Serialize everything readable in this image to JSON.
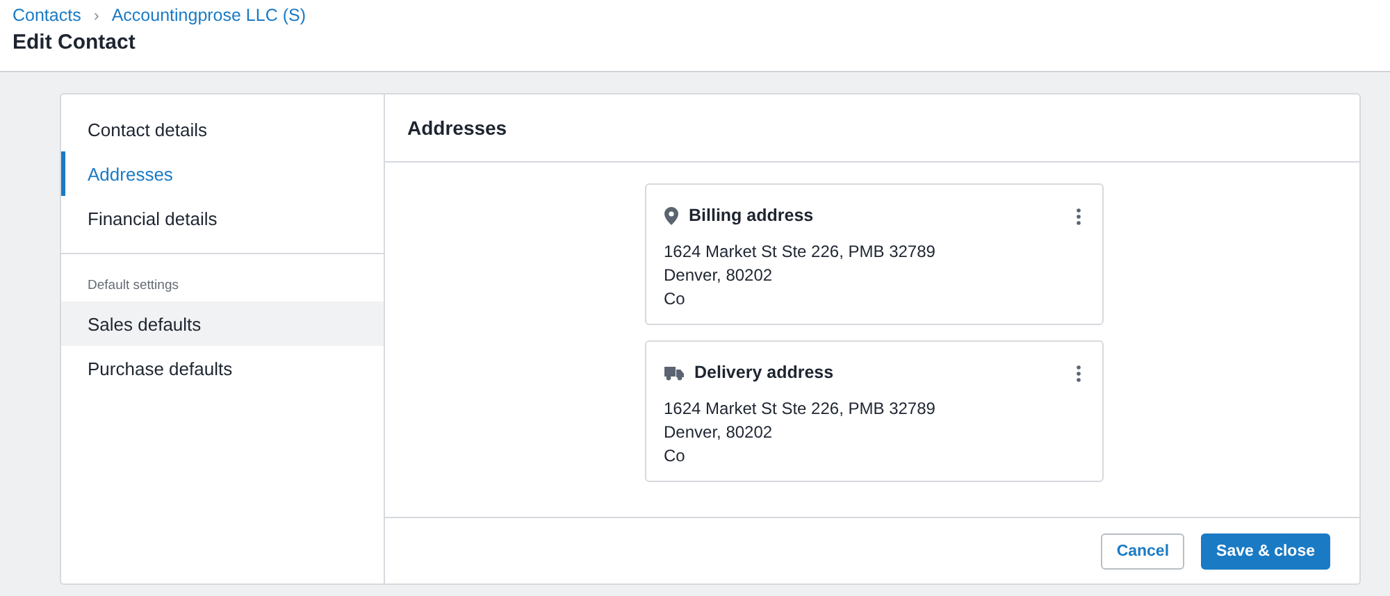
{
  "breadcrumb": [
    {
      "label": "Contacts"
    },
    {
      "label": "Accountingprose LLC (S)"
    }
  ],
  "breadcrumb_separator": "›",
  "page_title": "Edit Contact",
  "sidebar": {
    "items": [
      {
        "label": "Contact details",
        "selected": false,
        "hovered": false
      },
      {
        "label": "Addresses",
        "selected": true,
        "hovered": false
      },
      {
        "label": "Financial details",
        "selected": false,
        "hovered": false
      }
    ],
    "section": {
      "heading": "Default settings",
      "items": [
        {
          "label": "Sales defaults",
          "selected": false,
          "hovered": true
        },
        {
          "label": "Purchase defaults",
          "selected": false,
          "hovered": false
        }
      ]
    }
  },
  "content": {
    "title": "Addresses",
    "cards": [
      {
        "kind": "billing",
        "title": "Billing address",
        "lines": [
          "1624 Market St Ste 226, PMB 32789",
          "Denver, 80202",
          "Co"
        ]
      },
      {
        "kind": "delivery",
        "title": "Delivery address",
        "lines": [
          "1624 Market St Ste 226, PMB 32789",
          "Denver, 80202",
          "Co"
        ]
      }
    ]
  },
  "buttons": [
    {
      "kind": "secondary",
      "label": "Cancel"
    },
    {
      "kind": "primary",
      "label": "Save & close"
    }
  ]
}
